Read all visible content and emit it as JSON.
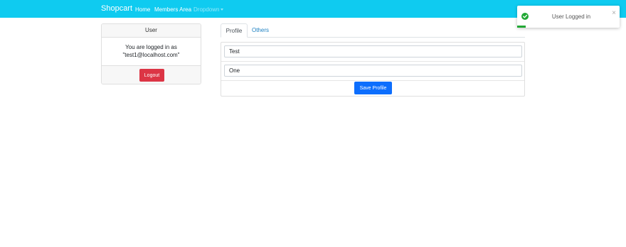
{
  "navbar": {
    "brand": "Shopcart",
    "links": [
      "Home",
      "Members Area"
    ],
    "dropdown": "Dropdown"
  },
  "user_card": {
    "header": "User",
    "line1": "You are logged in as",
    "line2": "\"test1@localhost.com\"",
    "logout_label": "Logout"
  },
  "tabs": [
    {
      "label": "Profile",
      "active": true
    },
    {
      "label": "Others",
      "active": false
    }
  ],
  "profile_form": {
    "first_name": "Test",
    "last_name": "One",
    "save_label": "Save Profile"
  },
  "toast": {
    "message": "User Logged in",
    "close": "×",
    "icon": "check-circle-icon"
  },
  "colors": {
    "navbar": "#0fcbf0",
    "danger": "#dc3545",
    "primary": "#0d6efd",
    "success": "#22a835",
    "link": "#1a7fc1"
  }
}
